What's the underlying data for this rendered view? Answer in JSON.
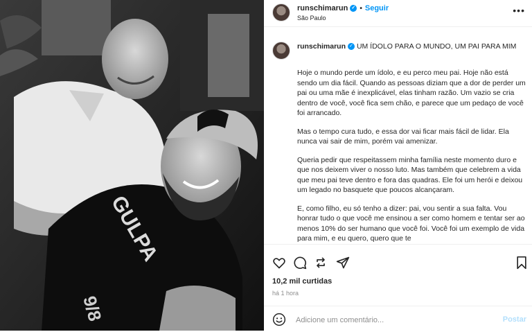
{
  "header": {
    "username": "runschimarun",
    "follow_label": "Seguir",
    "location": "São Paulo",
    "separator": "•"
  },
  "caption": {
    "username": "runschimarun",
    "headline": "UM ÍDOLO PARA O MUNDO, UM PAI PARA MIM",
    "paragraphs": [
      "Hoje o mundo perde um ídolo, e eu perco meu pai. Hoje não está sendo um dia fácil. Quando as pessoas diziam que a dor de perder um pai ou uma mãe é inexplicável, elas tinham razão. Um vazio se cria dentro de você, você fica sem chão, e parece que um pedaço de você foi arrancado.",
      "Mas o tempo cura tudo, e essa dor vai ficar mais fácil de lidar. Ela nunca vai sair de mim, porém vai amenizar.",
      "Queria pedir que respeitassem minha família neste momento duro e que nos deixem viver o nosso luto. Mas também que celebrem a vida que meu pai teve dentro e fora das quadras. Ele foi um herói e deixou um legado no basquete que poucos alcançaram.",
      "E, como filho, eu só tenho a dizer: pai, vou sentir a sua falta. Vou honrar tudo o que você me ensinou a ser como homem e tentar ser ao menos 10% do ser humano que você foi. Você foi um exemplo de vida para mim, e eu quero, quero que te"
    ]
  },
  "engagement": {
    "likes": "10,2 mil curtidas",
    "time": "há 1 hora"
  },
  "comment": {
    "placeholder": "Adicione um comentário...",
    "post_label": "Postar"
  },
  "colors": {
    "accent": "#0095f6",
    "muted": "#8e8e8e",
    "post_disabled": "#b2dffc"
  },
  "icons": [
    "verified-badge-icon",
    "more-options-icon",
    "heart-icon",
    "comment-icon",
    "share-icon",
    "bookmark-icon",
    "emoji-icon"
  ]
}
